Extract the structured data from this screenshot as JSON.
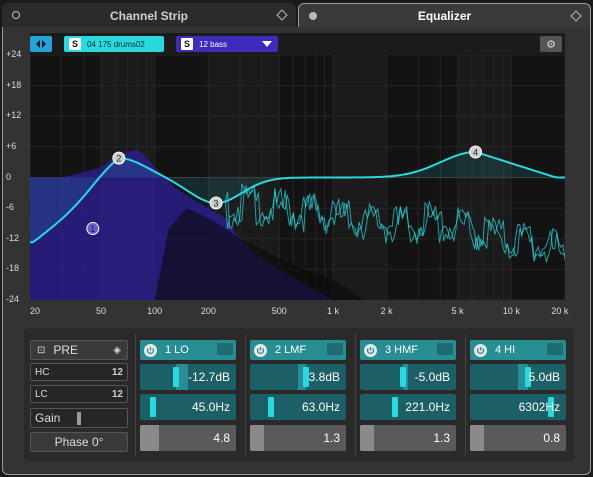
{
  "tabs": [
    {
      "label": "Channel Strip",
      "active": false
    },
    {
      "label": "Equalizer",
      "active": true
    }
  ],
  "toolbar": {
    "track_a": {
      "badge": "S",
      "label": "04 175 drums02",
      "color": "#2ad8e0"
    },
    "track_b": {
      "badge": "S",
      "label": "12 bass",
      "color": "#3d2cb8"
    }
  },
  "graph": {
    "y_labels": [
      "+24",
      "+18",
      "+12",
      "+6",
      "0",
      "-6",
      "-12",
      "-18",
      "-24"
    ],
    "x_labels": [
      "20",
      "50",
      "100",
      "200",
      "500",
      "1 k",
      "2 k",
      "5 k",
      "10 k",
      "20 k"
    ],
    "nodes": [
      {
        "id": "1",
        "freq_hz": 45,
        "gain_db": -12.7
      },
      {
        "id": "2",
        "freq_hz": 63,
        "gain_db": 3.8
      },
      {
        "id": "3",
        "freq_hz": 221,
        "gain_db": -5.0
      },
      {
        "id": "4",
        "freq_hz": 6302,
        "gain_db": 5.0
      }
    ],
    "colors": {
      "curve": "#2ad8e0",
      "spectrum": "#2a1f8a",
      "background": "#131313"
    }
  },
  "left": {
    "pre_label": "PRE",
    "hc_label": "HC",
    "lc_label": "LC",
    "gain_label": "Gain",
    "phase_label": "Phase 0°"
  },
  "bands": [
    {
      "name": "1 LO",
      "gain": "-12.7dB",
      "freq": "45.0Hz",
      "q": "4.8",
      "gain_frac": 0.37,
      "freq_frac": 0.14,
      "q_frac": 0.2
    },
    {
      "name": "2 LMF",
      "gain": "3.8dB",
      "freq": "63.0Hz",
      "q": "1.3",
      "gain_frac": 0.58,
      "freq_frac": 0.22,
      "q_frac": 0.05
    },
    {
      "name": "3 HMF",
      "gain": "-5.0dB",
      "freq": "221.0Hz",
      "q": "1.3",
      "gain_frac": 0.45,
      "freq_frac": 0.36,
      "q_frac": 0.05
    },
    {
      "name": "4 HI",
      "gain": "5.0dB",
      "freq": "6302Hz",
      "q": "0.8",
      "gain_frac": 0.6,
      "freq_frac": 0.84,
      "q_frac": 0.03
    }
  ]
}
